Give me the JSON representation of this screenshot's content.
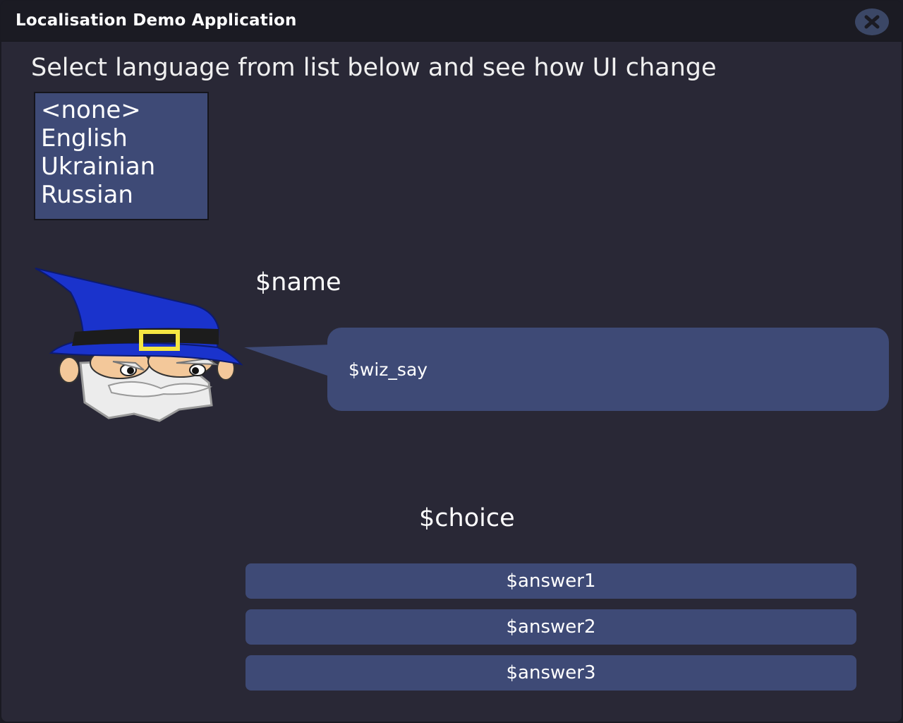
{
  "window": {
    "title": "Localisation Demo Application",
    "close_icon": "close-icon"
  },
  "instruction": "Select language from list below and see how UI change",
  "languages": {
    "items": [
      "<none>",
      "English",
      "Ukrainian",
      "Russian"
    ]
  },
  "dialog": {
    "avatar_icon": "wizard-icon",
    "name": "$name",
    "speech": "$wiz_say",
    "choice_prompt": "$choice",
    "answers": [
      "$answer1",
      "$answer2",
      "$answer3"
    ]
  },
  "colors": {
    "background": "#292836",
    "titlebar": "#1b1b23",
    "panel": "#3e4a76",
    "text": "#ffffff"
  }
}
